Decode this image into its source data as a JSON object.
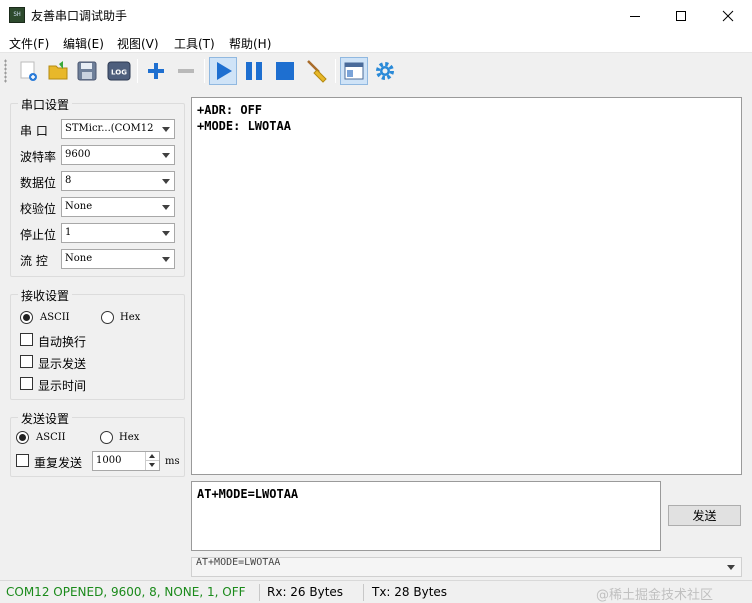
{
  "window": {
    "title": "友善串口调试助手",
    "icon_text": "SH"
  },
  "menu": [
    "文件(F)",
    "编辑(E)",
    "视图(V)",
    "工具(T)",
    "帮助(H)"
  ],
  "toolbar": {
    "buttons": [
      "new-icon",
      "open-folder-icon",
      "save-icon",
      "log-icon",
      "add-icon",
      "remove-icon",
      "play-icon",
      "pause-icon",
      "stop-icon",
      "broom-icon",
      "window-layout-icon",
      "gear-icon"
    ],
    "accent": "#1e6fd0"
  },
  "serial_settings": {
    "title": "串口设置",
    "port_label": "串  口",
    "port_value": "STMicr...(COM12",
    "baud_label": "波特率",
    "baud_value": "9600",
    "databits_label": "数据位",
    "databits_value": "8",
    "parity_label": "校验位",
    "parity_value": "None",
    "stopbits_label": "停止位",
    "stopbits_value": "1",
    "flow_label": "流  控",
    "flow_value": "None"
  },
  "receive_settings": {
    "title": "接收设置",
    "ascii": "ASCII",
    "hex": "Hex",
    "auto_wrap": "自动换行",
    "show_send": "显示发送",
    "show_time": "显示时间"
  },
  "send_settings": {
    "title": "发送设置",
    "ascii": "ASCII",
    "hex": "Hex",
    "repeat": "重复发送",
    "interval": "1000",
    "unit": "ms"
  },
  "receive_lines": [
    "+ADR: OFF",
    "+MODE: LWOTAA"
  ],
  "send_text": "AT+MODE=LWOTAA",
  "send_button": "发送",
  "history_text": "AT+MODE=LWOTAA",
  "status": {
    "connection": "COM12 OPENED, 9600, 8, NONE, 1, OFF",
    "connection_color": "#1a8a1a",
    "rx": "Rx: 26 Bytes",
    "tx": "Tx: 28 Bytes",
    "watermark": "@稀土掘金技术社区"
  }
}
